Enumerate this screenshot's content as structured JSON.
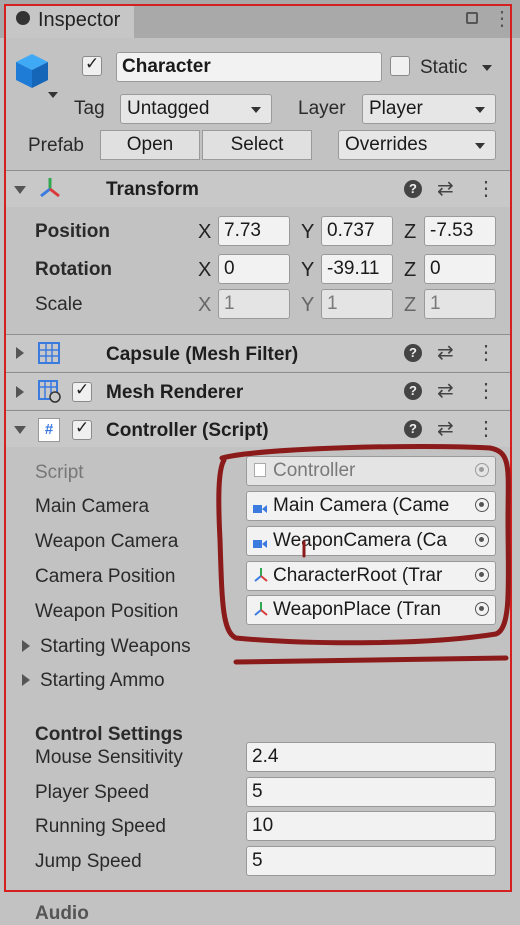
{
  "tab": {
    "title": "Inspector"
  },
  "object": {
    "name": "Character",
    "static_label": "Static",
    "tag_label": "Tag",
    "tag_value": "Untagged",
    "layer_label": "Layer",
    "layer_value": "Player",
    "prefab_label": "Prefab",
    "open_label": "Open",
    "select_label": "Select",
    "overrides_label": "Overrides"
  },
  "transform": {
    "title": "Transform",
    "position": {
      "label": "Position",
      "x": "7.73",
      "y": "0.737",
      "z": "-7.53"
    },
    "rotation": {
      "label": "Rotation",
      "x": "0",
      "y": "-39.11",
      "z": "0"
    },
    "scale": {
      "label": "Scale",
      "x": "1",
      "y": "1",
      "z": "1"
    },
    "x_axis": "X",
    "y_axis": "Y",
    "z_axis": "Z"
  },
  "mesh_filter": {
    "title": "Capsule (Mesh Filter)"
  },
  "mesh_renderer": {
    "title": "Mesh Renderer"
  },
  "controller": {
    "title": "Controller (Script)",
    "script": {
      "label": "Script",
      "value": "Controller"
    },
    "main_camera": {
      "label": "Main Camera",
      "value": "Main Camera (Came"
    },
    "weapon_camera": {
      "label": "Weapon Camera",
      "value": "WeaponCamera (Ca"
    },
    "camera_position": {
      "label": "Camera Position",
      "value": "CharacterRoot (Trar"
    },
    "weapon_position": {
      "label": "Weapon Position",
      "value": "WeaponPlace (Tran"
    },
    "starting_weapons": "Starting Weapons",
    "starting_ammo": "Starting Ammo",
    "control_settings": "Control Settings",
    "mouse_sensitivity": {
      "label": "Mouse Sensitivity",
      "value": "2.4"
    },
    "player_speed": {
      "label": "Player Speed",
      "value": "5"
    },
    "running_speed": {
      "label": "Running Speed",
      "value": "10"
    },
    "jump_speed": {
      "label": "Jump Speed",
      "value": "5"
    }
  },
  "audio": {
    "title": "Audio"
  },
  "colors": {
    "accent_red": "#d61f1f",
    "annotation": "#8b1a1a"
  }
}
